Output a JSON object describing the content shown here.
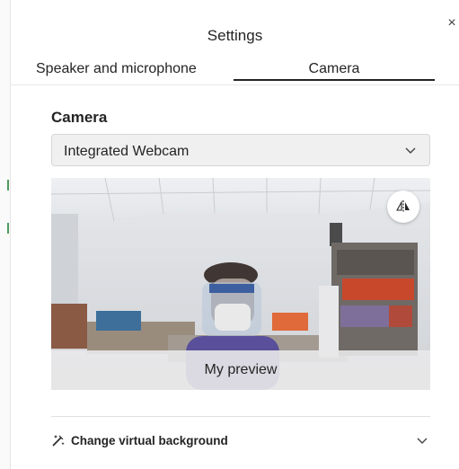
{
  "dialog": {
    "title": "Settings",
    "close_icon": "close-icon"
  },
  "tabs": [
    {
      "label": "Speaker and microphone",
      "selected": false
    },
    {
      "label": "Camera",
      "selected": true
    }
  ],
  "camera": {
    "section_title": "Camera",
    "device": {
      "selected": "Integrated Webcam",
      "icon": "chevron-down-icon"
    },
    "preview": {
      "label": "My preview",
      "mirror_icon": "mirror-flip-icon"
    }
  },
  "virtual_background": {
    "label": "Change virtual background",
    "icon": "magic-wand-icon",
    "expand_icon": "chevron-down-icon"
  },
  "colors": {
    "tab_underline": "#242424",
    "dropdown_bg": "#f0f0f0"
  }
}
